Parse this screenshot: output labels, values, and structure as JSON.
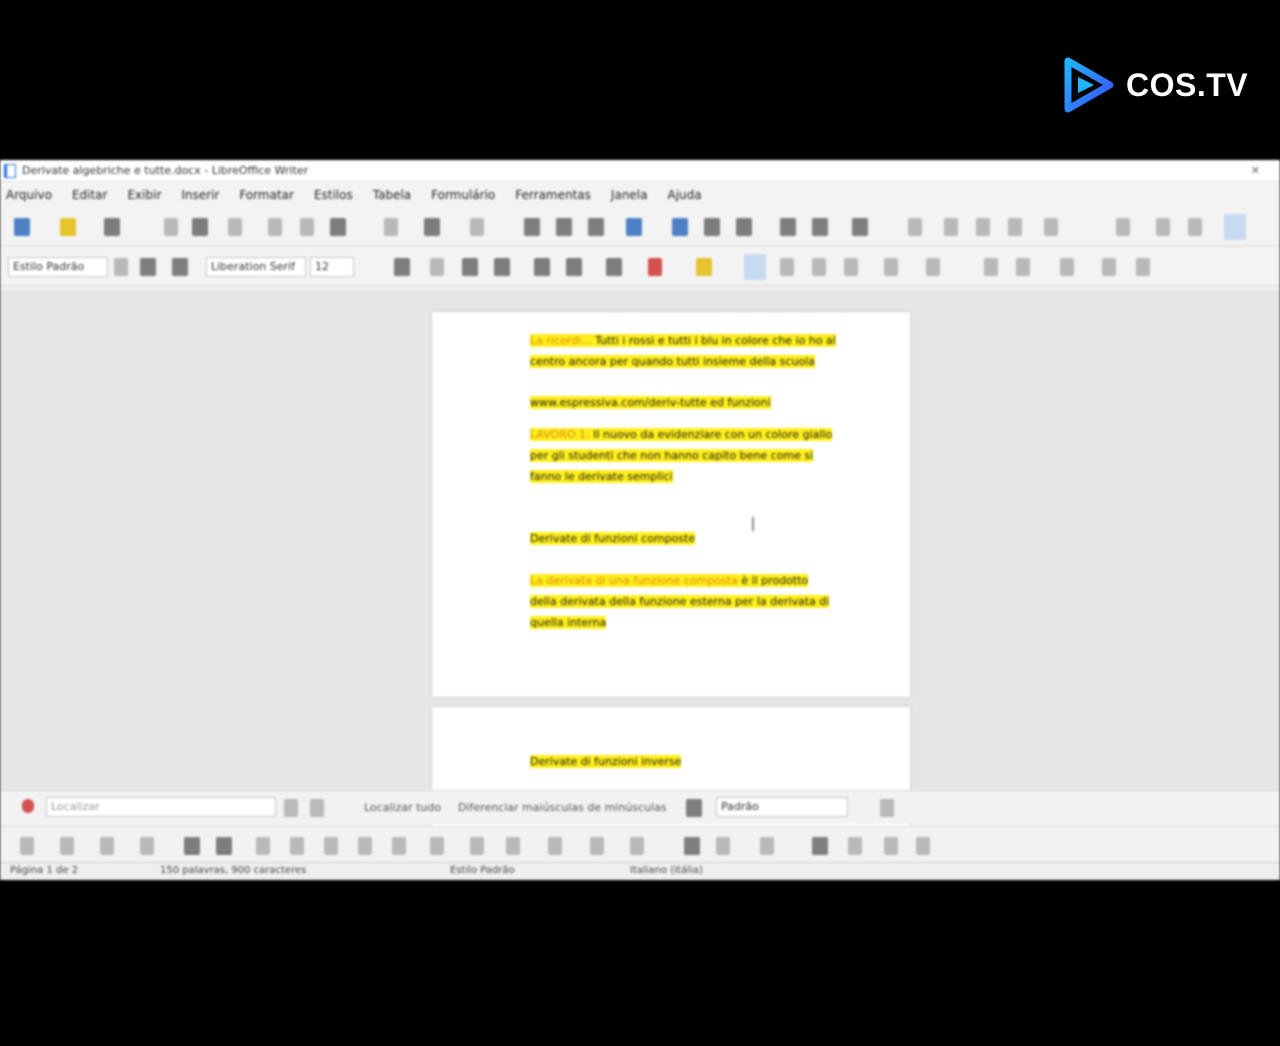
{
  "watermark": {
    "text": "COS.TV"
  },
  "window": {
    "title": "Derivate algebriche e tutte.docx - LibreOffice Writer"
  },
  "menu": [
    "Arquivo",
    "Editar",
    "Exibir",
    "Inserir",
    "Formatar",
    "Estilos",
    "Tabela",
    "Formulário",
    "Ferramentas",
    "Janela",
    "Ajuda"
  ],
  "formatting": {
    "paragraph_style": "Estilo Padrão",
    "font_name": "Liberation Serif",
    "font_size": "12"
  },
  "document": {
    "paragraphs": [
      {
        "segments": [
          {
            "text": "La ricordi... ",
            "orange": true
          },
          {
            "text": "Tutti i rossi e tutti i blu in colore che io ho al centro ancora per quando tutti insieme della scuola",
            "orange": false
          }
        ]
      },
      {
        "segments": [
          {
            "text": "www.espressiva.com/deriv-tutte ed funzioni",
            "orange": false
          }
        ]
      },
      {
        "segments": [
          {
            "text": "LAVORO 1: ",
            "orange": true
          },
          {
            "text": "Il nuovo da evidenziare con un colore giallo per gli studenti che non hanno capito bene come si fanno le derivate semplici",
            "orange": false
          }
        ]
      },
      {
        "segments": [
          {
            "text": "Derivate di funzioni composte",
            "orange": false
          }
        ]
      },
      {
        "segments": [
          {
            "text": "La derivata di una funzione composta ",
            "orange": true
          },
          {
            "text": "è il prodotto della derivata della funzione esterna per la derivata di quella interna",
            "orange": false
          }
        ]
      }
    ],
    "page2_paragraphs": [
      {
        "segments": [
          {
            "text": "Derivate di funzioni inverse",
            "orange": false
          }
        ]
      }
    ]
  },
  "find": {
    "placeholder": "Localizar",
    "find_all_label": "Localizar tudo",
    "options_label": "Diferenciar maiúsculas de minúsculas",
    "style_select": "Padrão"
  },
  "status": {
    "page": "Página 1 de 2",
    "words": "150 palavras, 900 caracteres",
    "style": "Estilo Padrão",
    "language": "Italiano (Itália)"
  }
}
